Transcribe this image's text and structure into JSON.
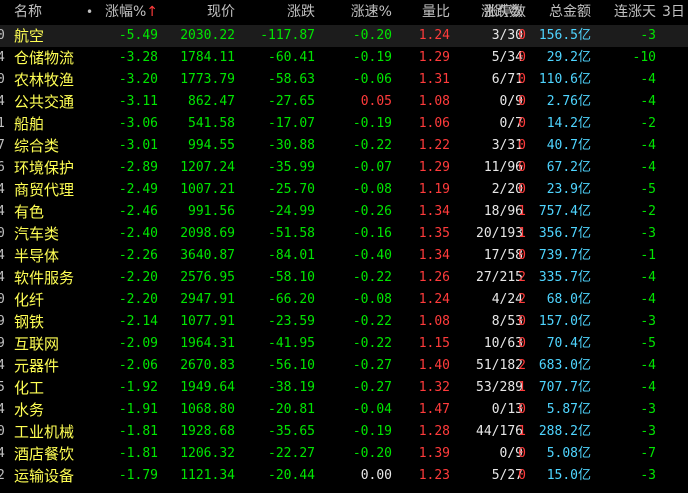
{
  "headers": {
    "name": "名称",
    "dot": "•",
    "pct": "涨幅%",
    "pct_arrow": "↑",
    "price": "现价",
    "change": "涨跌",
    "speed": "涨速%",
    "vol_ratio": "量比",
    "updown": "涨跌数",
    "stops": "涨停数",
    "amount": "总金额",
    "days": "连涨天",
    "day3": "3日"
  },
  "rows": [
    {
      "idx": "0",
      "name": "航空",
      "pct": "-5.49",
      "price": "2030.22",
      "chg": "-117.87",
      "spd": "-0.20",
      "vr": "1.24",
      "ud": "3/30",
      "stop": "0",
      "amt": "156.5亿",
      "days": "-3",
      "highlight": true
    },
    {
      "idx": "4",
      "name": "仓储物流",
      "pct": "-3.28",
      "price": "1784.11",
      "chg": "-60.41",
      "spd": "-0.19",
      "vr": "1.29",
      "ud": "5/34",
      "stop": "0",
      "amt": "29.2亿",
      "days": "-10"
    },
    {
      "idx": "0",
      "name": "农林牧渔",
      "pct": "-3.20",
      "price": "1773.79",
      "chg": "-58.63",
      "spd": "-0.06",
      "vr": "1.31",
      "ud": "6/71",
      "stop": "0",
      "amt": "110.6亿",
      "days": "-4"
    },
    {
      "idx": "4",
      "name": "公共交通",
      "pct": "-3.11",
      "price": "862.47",
      "chg": "-27.65",
      "spd": "0.05",
      "vr": "1.08",
      "ud": "0/9",
      "stop": "0",
      "amt": "2.76亿",
      "days": "-4",
      "spd_red": true
    },
    {
      "idx": "1",
      "name": "船舶",
      "pct": "-3.06",
      "price": "541.58",
      "chg": "-17.07",
      "spd": "-0.19",
      "vr": "1.06",
      "ud": "0/7",
      "stop": "0",
      "amt": "14.2亿",
      "days": "-2"
    },
    {
      "idx": "7",
      "name": "综合类",
      "pct": "-3.01",
      "price": "994.55",
      "chg": "-30.88",
      "spd": "-0.22",
      "vr": "1.22",
      "ud": "3/31",
      "stop": "0",
      "amt": "40.7亿",
      "days": "-4"
    },
    {
      "idx": "6",
      "name": "环境保护",
      "pct": "-2.89",
      "price": "1207.24",
      "chg": "-35.99",
      "spd": "-0.07",
      "vr": "1.29",
      "ud": "11/96",
      "stop": "0",
      "amt": "67.2亿",
      "days": "-4"
    },
    {
      "idx": "4",
      "name": "商贸代理",
      "pct": "-2.49",
      "price": "1007.21",
      "chg": "-25.70",
      "spd": "-0.08",
      "vr": "1.19",
      "ud": "2/20",
      "stop": "0",
      "amt": "23.9亿",
      "days": "-5"
    },
    {
      "idx": "4",
      "name": "有色",
      "pct": "-2.46",
      "price": "991.56",
      "chg": "-24.99",
      "spd": "-0.26",
      "vr": "1.34",
      "ud": "18/96",
      "stop": "1",
      "amt": "757.4亿",
      "days": "-2"
    },
    {
      "idx": "0",
      "name": "汽车类",
      "pct": "-2.40",
      "price": "2098.69",
      "chg": "-51.58",
      "spd": "-0.16",
      "vr": "1.35",
      "ud": "20/193",
      "stop": "1",
      "amt": "356.7亿",
      "days": "-3"
    },
    {
      "idx": "4",
      "name": "半导体",
      "pct": "-2.26",
      "price": "3640.87",
      "chg": "-84.01",
      "spd": "-0.40",
      "vr": "1.34",
      "ud": "17/58",
      "stop": "0",
      "amt": "739.7亿",
      "days": "-1"
    },
    {
      "idx": "4",
      "name": "软件服务",
      "pct": "-2.20",
      "price": "2576.95",
      "chg": "-58.10",
      "spd": "-0.22",
      "vr": "1.26",
      "ud": "27/215",
      "stop": "2",
      "amt": "335.7亿",
      "days": "-4"
    },
    {
      "idx": "0",
      "name": "化纤",
      "pct": "-2.20",
      "price": "2947.91",
      "chg": "-66.20",
      "spd": "-0.08",
      "vr": "1.24",
      "ud": "4/24",
      "stop": "2",
      "amt": "68.0亿",
      "days": "-4"
    },
    {
      "idx": "9",
      "name": "钢铁",
      "pct": "-2.14",
      "price": "1077.91",
      "chg": "-23.59",
      "spd": "-0.22",
      "vr": "1.08",
      "ud": "8/53",
      "stop": "0",
      "amt": "157.0亿",
      "days": "-3"
    },
    {
      "idx": "9",
      "name": "互联网",
      "pct": "-2.09",
      "price": "1964.31",
      "chg": "-41.95",
      "spd": "-0.22",
      "vr": "1.15",
      "ud": "10/63",
      "stop": "0",
      "amt": "70.4亿",
      "days": "-5"
    },
    {
      "idx": "4",
      "name": "元器件",
      "pct": "-2.06",
      "price": "2670.83",
      "chg": "-56.10",
      "spd": "-0.27",
      "vr": "1.40",
      "ud": "51/182",
      "stop": "2",
      "amt": "683.0亿",
      "days": "-4"
    },
    {
      "idx": "5",
      "name": "化工",
      "pct": "-1.92",
      "price": "1949.64",
      "chg": "-38.19",
      "spd": "-0.27",
      "vr": "1.32",
      "ud": "53/289",
      "stop": "1",
      "amt": "707.7亿",
      "days": "-4"
    },
    {
      "idx": "4",
      "name": "水务",
      "pct": "-1.91",
      "price": "1068.80",
      "chg": "-20.81",
      "spd": "-0.04",
      "vr": "1.47",
      "ud": "0/13",
      "stop": "0",
      "amt": "5.87亿",
      "days": "-3"
    },
    {
      "idx": "0",
      "name": "工业机械",
      "pct": "-1.81",
      "price": "1928.68",
      "chg": "-35.65",
      "spd": "-0.19",
      "vr": "1.28",
      "ud": "44/176",
      "stop": "1",
      "amt": "288.2亿",
      "days": "-3"
    },
    {
      "idx": "4",
      "name": "酒店餐饮",
      "pct": "-1.81",
      "price": "1206.32",
      "chg": "-22.27",
      "spd": "-0.20",
      "vr": "1.39",
      "ud": "0/9",
      "stop": "0",
      "amt": "5.08亿",
      "days": "-7"
    },
    {
      "idx": "2",
      "name": "运输设备",
      "pct": "-1.79",
      "price": "1121.34",
      "chg": "-20.44",
      "spd": "0.00",
      "vr": "1.23",
      "ud": "5/27",
      "stop": "0",
      "amt": "15.0亿",
      "days": "-3",
      "spd_white": true
    }
  ],
  "colors": {
    "name": "#ffff54",
    "down": "#00e600",
    "up": "#ff3b3b",
    "amount": "#4fd5ff",
    "neutral": "#e8e8e8",
    "background": "#000000"
  }
}
